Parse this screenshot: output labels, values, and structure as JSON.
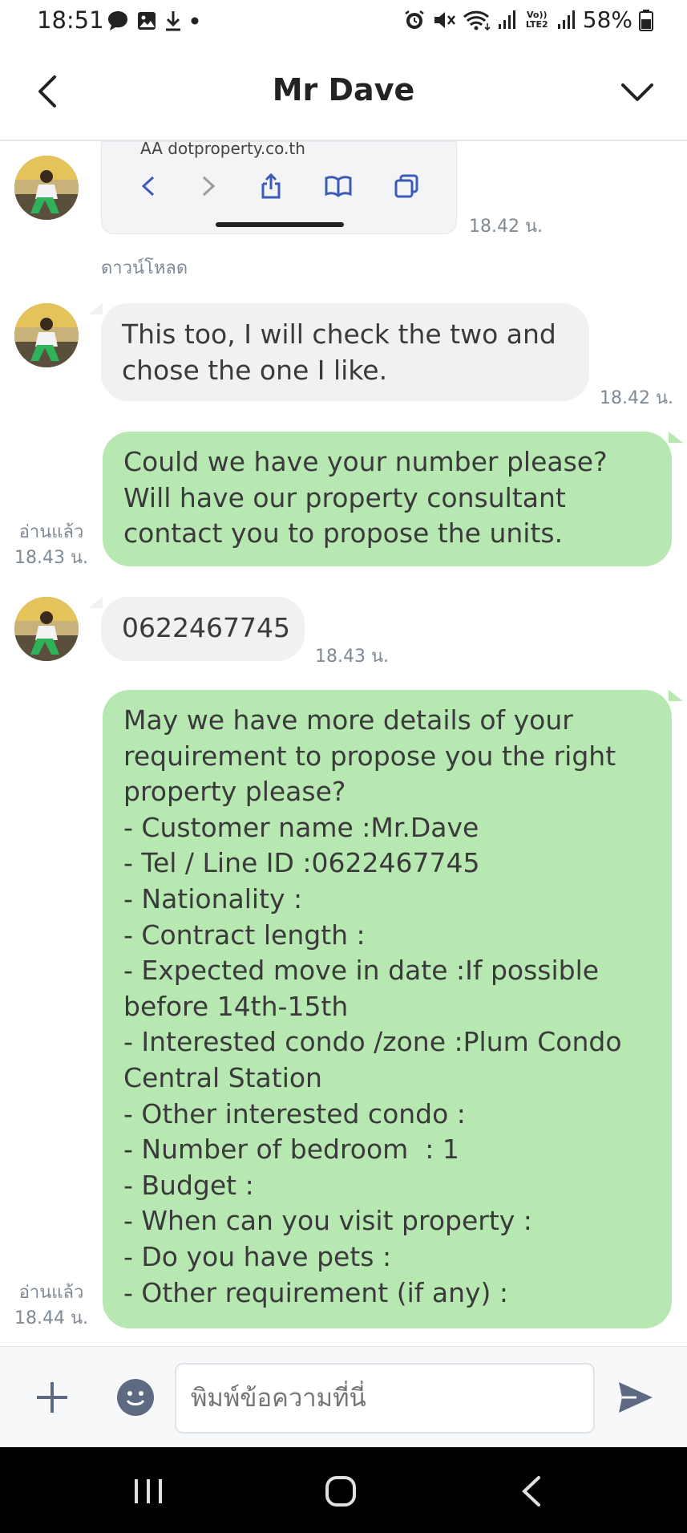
{
  "status_bar": {
    "time": "18:51",
    "battery": "58%",
    "left_icons": [
      "chat-bubble-icon",
      "image-icon",
      "download-icon",
      "dot-icon"
    ],
    "right_icons": [
      "alarm-icon",
      "mute-icon",
      "wifi-icon",
      "signal-icon",
      "volte-icon",
      "signal-icon",
      "battery-icon"
    ],
    "volte_label": "Vo)) LTE2"
  },
  "header": {
    "title": "Mr Dave",
    "back_icon": "chevron-left-icon",
    "menu_icon": "chevron-down-icon"
  },
  "messages": {
    "image_msg": {
      "url_text": "AA    dotproperty.co.th",
      "time": "18.42 น.",
      "download_label": "ดาวน์โหลด"
    },
    "msg1": {
      "text": "This too, I will check the two and chose the one I like.",
      "time": "18.42 น."
    },
    "msg2": {
      "text": "Could we have your number please? Will have our property consultant contact you to propose the units.",
      "read": "อ่านแล้ว",
      "time": "18.43 น."
    },
    "msg3": {
      "text": "0622467745",
      "time": "18.43 น."
    },
    "msg4": {
      "lines": [
        "May we have more details of your requirement to propose you the right property please?",
        "- Customer name :Mr.Dave",
        "- Tel / Line ID :0622467745",
        "- Nationality :",
        "- Contract length :",
        "- Expected move in date :If possible before 14th-15th",
        "- Interested condo /zone :Plum Condo Central Station",
        "- Other interested condo :",
        "- Number of bedroom  : 1",
        "- Budget :",
        "- When can you visit property :",
        "- Do you have pets :",
        "- Other requirement (if any) :"
      ],
      "read": "อ่านแล้ว",
      "time": "18.44 น."
    }
  },
  "composer": {
    "placeholder": "พิมพ์ข้อความที่นี่"
  },
  "colors": {
    "outgoing_bubble": "#b7e8b2",
    "incoming_bubble": "#f0f1f3",
    "send_icon": "#5d6a82"
  }
}
